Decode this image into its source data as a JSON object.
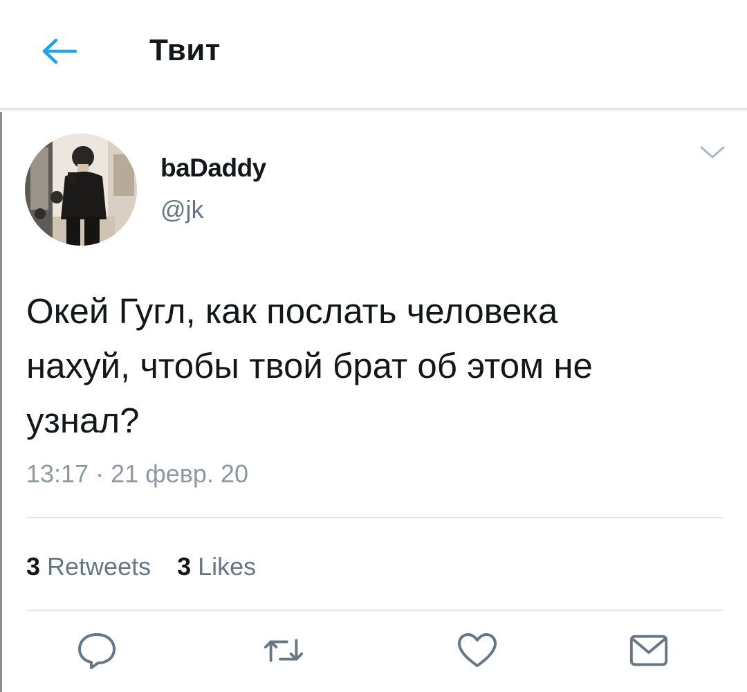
{
  "header": {
    "title": "Твит",
    "back_icon": "arrow-left-icon",
    "accent": "#1da1f2"
  },
  "tweet": {
    "author": {
      "display_name": "baDaddy",
      "handle": "@jk"
    },
    "lines": [
      "Окей Гугл, как послать человека",
      "нахуй, чтобы твой брат об этом не",
      "узнал?"
    ],
    "timestamp": "13:17 · 21 февр. 20",
    "stats": {
      "retweets_count": "3",
      "retweets_label": "Retweets",
      "likes_count": "3",
      "likes_label": "Likes"
    }
  },
  "actions": [
    {
      "name": "reply-icon"
    },
    {
      "name": "retweet-icon"
    },
    {
      "name": "like-icon"
    },
    {
      "name": "share-icon"
    }
  ],
  "colors": {
    "text": "#14171a",
    "secondary": "#657786",
    "icon": "#657786",
    "divider": "#e1e8ed"
  }
}
